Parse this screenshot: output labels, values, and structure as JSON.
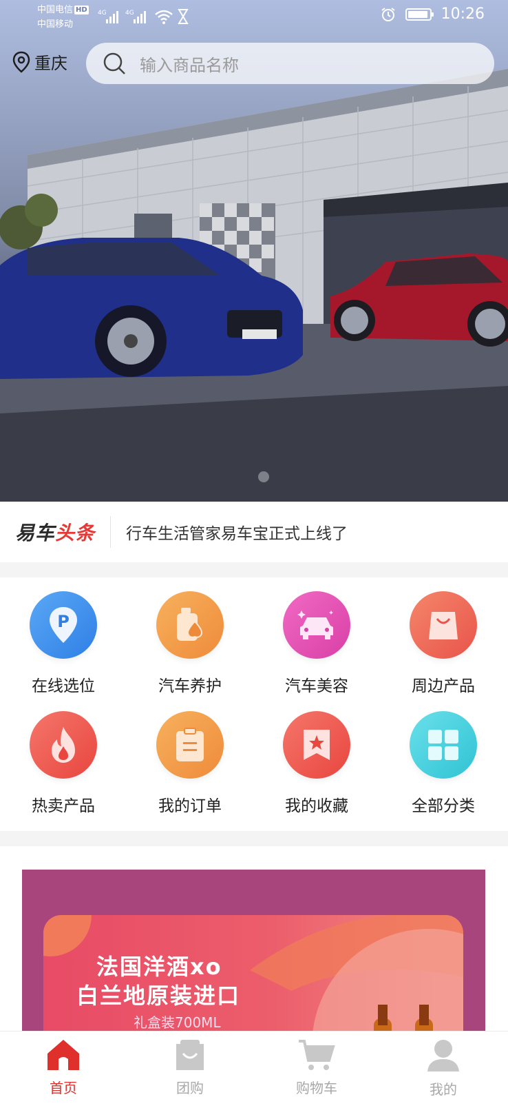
{
  "status_bar": {
    "carrier_1": "中国电信",
    "carrier_1_badge": "HD",
    "carrier_2": "中国移动",
    "network_1": "4G",
    "network_2": "4G",
    "time": "10:26"
  },
  "header": {
    "location": "重庆",
    "search_placeholder": "输入商品名称"
  },
  "news": {
    "logo_part1": "易车",
    "logo_part2": "头条",
    "headline": "行车生活管家易车宝正式上线了"
  },
  "menu": [
    {
      "label": "在线选位",
      "icon": "parking-pin-icon"
    },
    {
      "label": "汽车养护",
      "icon": "oil-bottle-icon"
    },
    {
      "label": "汽车美容",
      "icon": "car-wash-icon"
    },
    {
      "label": "周边产品",
      "icon": "shopping-bag-icon"
    },
    {
      "label": "热卖产品",
      "icon": "fire-icon"
    },
    {
      "label": "我的订单",
      "icon": "clipboard-icon"
    },
    {
      "label": "我的收藏",
      "icon": "bookmark-star-icon"
    },
    {
      "label": "全部分类",
      "icon": "grid-icon"
    }
  ],
  "banner": {
    "title_line1": "法国洋酒xo",
    "title_line2": "白兰地原装进口",
    "subtitle": "礼盒装700ML"
  },
  "tabbar": [
    {
      "label": "首页",
      "icon": "home-icon",
      "active": true
    },
    {
      "label": "团购",
      "icon": "group-buy-bag-icon",
      "active": false
    },
    {
      "label": "购物车",
      "icon": "cart-icon",
      "active": false
    },
    {
      "label": "我的",
      "icon": "user-icon",
      "active": false
    }
  ],
  "colors": {
    "accent": "#e0302c",
    "inactive": "#a8a8a8",
    "banner_bg": "#a8457c"
  }
}
